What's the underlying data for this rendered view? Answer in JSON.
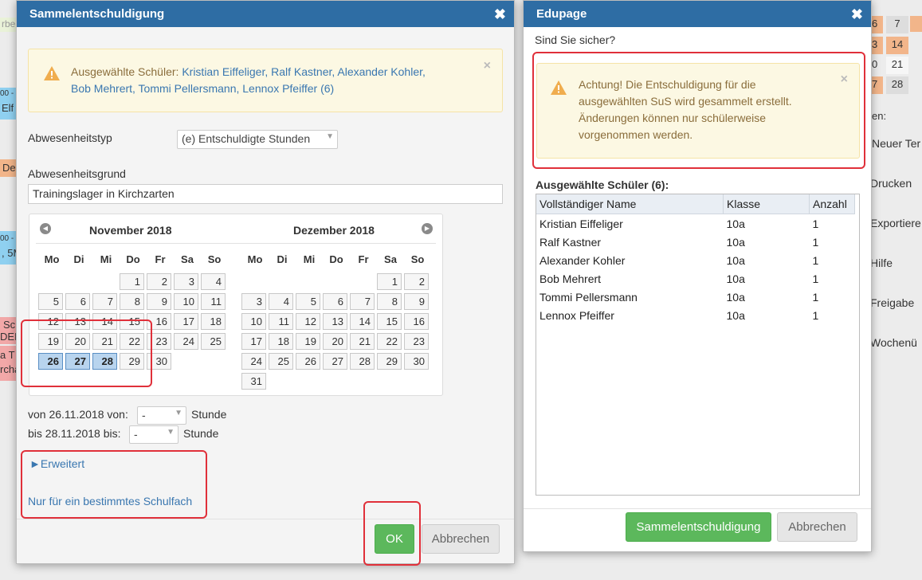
{
  "background": {
    "right_numbers": [
      [
        "6",
        "7"
      ],
      [
        "3",
        "14"
      ],
      [
        "0",
        "21"
      ],
      [
        "7",
        "28"
      ]
    ],
    "right_menu": [
      "en:",
      "Neuer Ter",
      "Drucken",
      "Exportiere",
      "Hilfe",
      "Freigabe",
      "Wochenü"
    ],
    "left_snips": [
      "rbe",
      "00 -",
      "Elf",
      "De",
      "00 -",
      ", 5M",
      "Sc",
      "DEI",
      "a T",
      "rcha"
    ]
  },
  "dialog_left": {
    "title": "Sammelentschuldigung",
    "alert_prefix": "Ausgewählte Schüler: ",
    "alert_names_line1": "Kristian Eiffeliger, Ralf Kastner, Alexander Kohler,",
    "alert_names_line2": "Bob Mehrert, Tommi Pellersmann, Lennox Pfeiffer (6)",
    "absence_type_label": "Abwesenheitstyp",
    "absence_type_value": "(e) Entschuldigte Stunden",
    "absence_reason_label": "Abwesenheitsgrund",
    "absence_reason_value": "Trainingslager in Kirchzarten",
    "calendar": {
      "dow": [
        "Mo",
        "Di",
        "Mi",
        "Do",
        "Fr",
        "Sa",
        "So"
      ],
      "months": [
        {
          "title": "November 2018",
          "weeks": [
            [
              "",
              "",
              "",
              "1",
              "2",
              "3",
              "4"
            ],
            [
              "5",
              "6",
              "7",
              "8",
              "9",
              "10",
              "11"
            ],
            [
              "12",
              "13",
              "14",
              "15",
              "16",
              "17",
              "18"
            ],
            [
              "19",
              "20",
              "21",
              "22",
              "23",
              "24",
              "25"
            ],
            [
              "26",
              "27",
              "28",
              "29",
              "30",
              "",
              ""
            ]
          ],
          "selected": [
            "26",
            "27",
            "28"
          ]
        },
        {
          "title": "Dezember 2018",
          "weeks": [
            [
              "",
              "",
              "",
              "",
              "",
              "1",
              "2"
            ],
            [
              "3",
              "4",
              "5",
              "6",
              "7",
              "8",
              "9"
            ],
            [
              "10",
              "11",
              "12",
              "13",
              "14",
              "15",
              "16"
            ],
            [
              "17",
              "18",
              "19",
              "20",
              "21",
              "22",
              "23"
            ],
            [
              "24",
              "25",
              "26",
              "27",
              "28",
              "29",
              "30"
            ],
            [
              "31",
              "",
              "",
              "",
              "",
              "",
              ""
            ]
          ],
          "selected": []
        }
      ]
    },
    "from_text": "von 26.11.2018 von:",
    "from_select": "-",
    "to_text": "bis 28.11.2018 bis:",
    "to_select": "-",
    "unit_label": "Stunde",
    "advanced_link": "►Erweitert",
    "subject_link": "Nur für ein bestimmtes Schulfach",
    "ok_button": "OK",
    "cancel_button": "Abbrechen"
  },
  "dialog_right": {
    "title": "Edupage",
    "question": "Sind Sie sicher?",
    "alert_lines": [
      "Achtung! Die Entschuldigung für die",
      "ausgewählten SuS wird gesammelt erstellt.",
      "Änderungen können nur schülerweise",
      "vorgenommen werden."
    ],
    "students_heading": "Ausgewählte Schüler (6):",
    "columns": [
      "Vollständiger Name",
      "Klasse",
      "Anzahl"
    ],
    "rows": [
      [
        "Kristian Eiffeliger",
        "10a",
        "1"
      ],
      [
        "Ralf Kastner",
        "10a",
        "1"
      ],
      [
        "Alexander Kohler",
        "10a",
        "1"
      ],
      [
        "Bob Mehrert",
        "10a",
        "1"
      ],
      [
        "Tommi Pellersmann",
        "10a",
        "1"
      ],
      [
        "Lennox Pfeiffer",
        "10a",
        "1"
      ]
    ],
    "confirm_button": "Sammelentschuldigung",
    "cancel_button": "Abbrechen"
  },
  "colors": {
    "header_blue": "#2e6da4",
    "alert_bg": "#fcf8e3",
    "alert_text": "#8a6d3b",
    "link_blue": "#3a77b0",
    "selected_day": "#b8d4ee",
    "ok_green": "#5cb85c",
    "annotation_red": "#e0303a"
  }
}
